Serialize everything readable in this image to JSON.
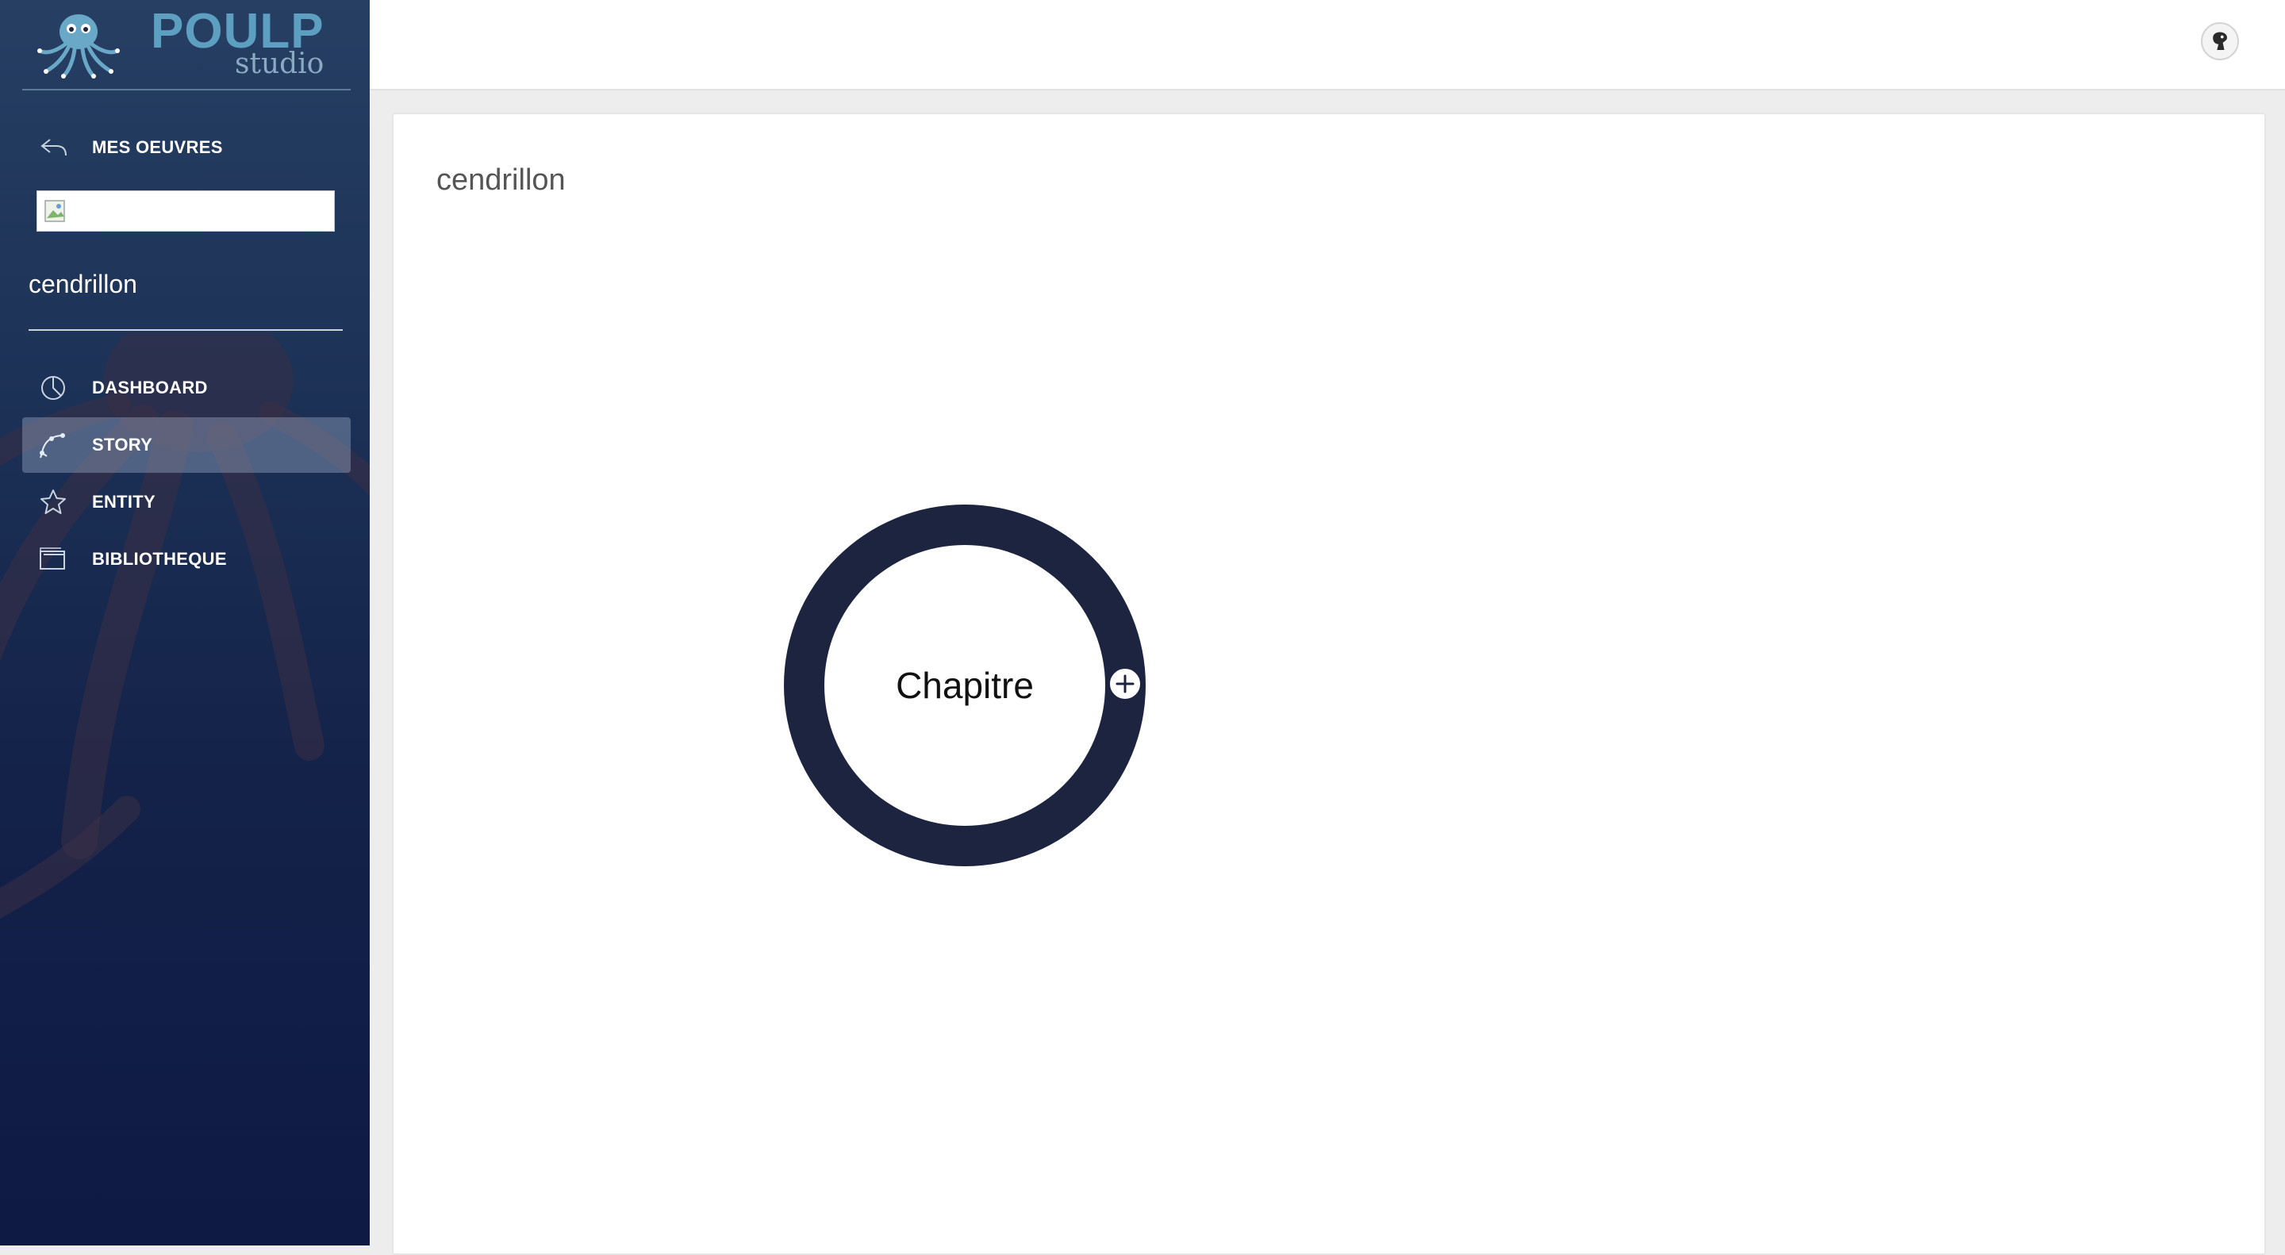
{
  "brand": {
    "name": "POULP",
    "sub": "studio"
  },
  "sidebar": {
    "back_label": "MES OEUVRES",
    "project_name": "cendrillon",
    "items": [
      {
        "label": "DASHBOARD",
        "icon": "pie-chart-icon",
        "active": false
      },
      {
        "label": "STORY",
        "icon": "story-graph-icon",
        "active": true
      },
      {
        "label": "ENTITY",
        "icon": "star-icon",
        "active": false
      },
      {
        "label": "BIBLIOTHEQUE",
        "icon": "library-icon",
        "active": false
      }
    ]
  },
  "main": {
    "title": "cendrillon",
    "nodes": [
      {
        "label": "Chapitre"
      }
    ]
  },
  "colors": {
    "node_ring": "#1c2440",
    "sidebar_top": "#263f63",
    "sidebar_bottom": "#0e1944",
    "brand": "#5c9fc0"
  }
}
